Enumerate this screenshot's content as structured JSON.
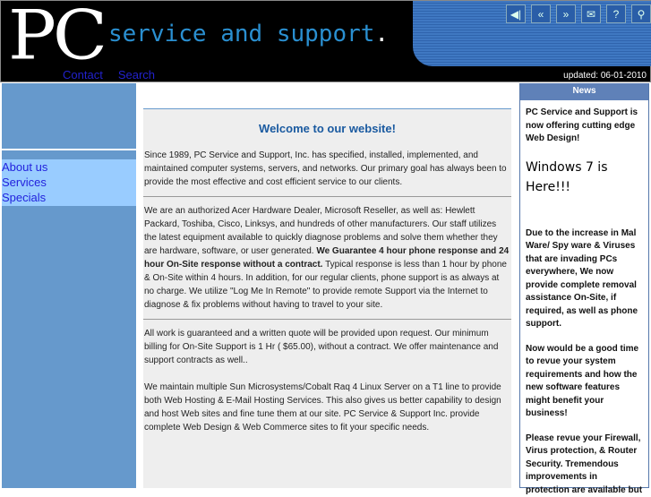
{
  "header": {
    "logo_pc": "PC",
    "logo_text": "service and support",
    "logo_dot": ".",
    "links": [
      "Contact",
      "Search"
    ],
    "updated": "updated: 06-01-2010",
    "icons": [
      {
        "name": "sound-icon",
        "glyph": "◀|"
      },
      {
        "name": "rewind-icon",
        "glyph": "«"
      },
      {
        "name": "forward-icon",
        "glyph": "»"
      },
      {
        "name": "mail-icon",
        "glyph": "✉"
      },
      {
        "name": "help-icon",
        "glyph": "?"
      },
      {
        "name": "search-icon",
        "glyph": "⚲"
      }
    ]
  },
  "sidebar": {
    "items": [
      "About us",
      "Services",
      "Specials"
    ]
  },
  "main": {
    "title": "Welcome to our website!",
    "p1": "Since 1989, PC Service and Support, Inc. has specified, installed, implemented, and maintained computer systems, servers, and networks.  Our primary goal has always been to provide the most effective and cost efficient service to our clients.",
    "p2a": "We are an authorized Acer Hardware Dealer, Microsoft Reseller, as well as:   Hewlett Packard,  Toshiba, Cisco, Linksys,  and hundreds of other manufacturers. Our staff utilizes the latest equipment available to quickly diagnose problems and solve them whether they are hardware, software, or user generated. ",
    "p2b": "We Guarantee 4 hour phone response and 24 hour On-Site response  without a contract.",
    "p2c": " Typical response is less than 1 hour by phone & On-Site within 4 hours. In addition, for our regular clients, phone support is as always at no charge. We utilize \"Log Me In Remote\" to provide remote Support via the Internet to diagnose & fix problems without having to travel to your site.",
    "p3": "All work is guaranteed and a written quote will be provided upon request.  Our minimum billing for On-Site Support is 1 Hr ( $65.00), without a contract. We offer maintenance and support contracts as well..",
    "p4": "We maintain multiple Sun Microsystems/Cobalt Raq 4 Linux Server on a T1 line to provide both Web Hosting & E-Mail Hosting Services.  This also gives us better capability to design and host Web sites and fine tune them at our site. PC Service & Support Inc. provide complete Web Design & Web Commerce sites to fit your specific needs."
  },
  "news": {
    "title": "News",
    "items": [
      "PC Service and Support is now offering cutting edge Web Design!",
      "Windows 7 is Here!!!",
      "Due to the increase in Mal Ware/ Spy ware & Viruses that are invading PCs everywhere, We now provide complete removal assistance On-Site, if required, as well as phone support.",
      "Now would be a good time to revue your system requirements and how the new software features might benefit your business!",
      "Please revue your Firewall, Virus protection, & Router Security. Tremendous improvements in protection are available but"
    ]
  }
}
